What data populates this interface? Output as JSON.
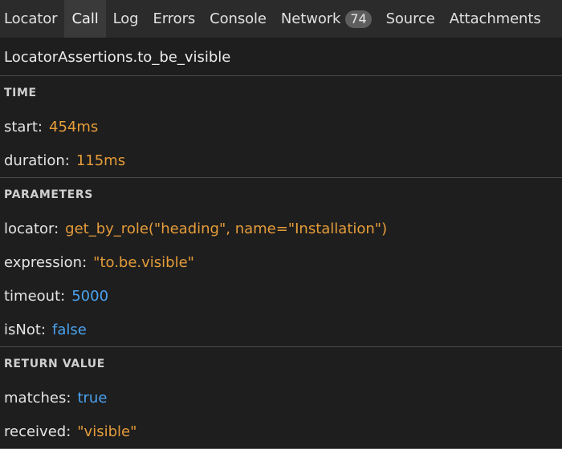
{
  "tabs": [
    {
      "label": "Locator"
    },
    {
      "label": "Call",
      "selected": true
    },
    {
      "label": "Log"
    },
    {
      "label": "Errors"
    },
    {
      "label": "Console"
    },
    {
      "label": "Network",
      "badge": "74"
    },
    {
      "label": "Source"
    },
    {
      "label": "Attachments"
    }
  ],
  "call_title": "LocatorAssertions.to_be_visible",
  "sections": {
    "time": {
      "title": "TIME",
      "start": {
        "key": "start:",
        "value": "454ms"
      },
      "duration": {
        "key": "duration:",
        "value": "115ms"
      }
    },
    "parameters": {
      "title": "PARAMETERS",
      "locator": {
        "key": "locator:",
        "value": "get_by_role(\"heading\", name=\"Installation\")"
      },
      "expression": {
        "key": "expression:",
        "value": "\"to.be.visible\""
      },
      "timeout": {
        "key": "timeout:",
        "value": "5000"
      },
      "isNot": {
        "key": "isNot:",
        "value": "false"
      }
    },
    "return_value": {
      "title": "RETURN VALUE",
      "matches": {
        "key": "matches:",
        "value": "true"
      },
      "received": {
        "key": "received:",
        "value": "\"visible\""
      }
    }
  },
  "colors": {
    "background": "#1e1e1e",
    "tabbar": "#2b2b2b",
    "selected_tab": "#3a3a3a",
    "string_value": "#e59c3a",
    "literal_value": "#4aa3f0"
  }
}
